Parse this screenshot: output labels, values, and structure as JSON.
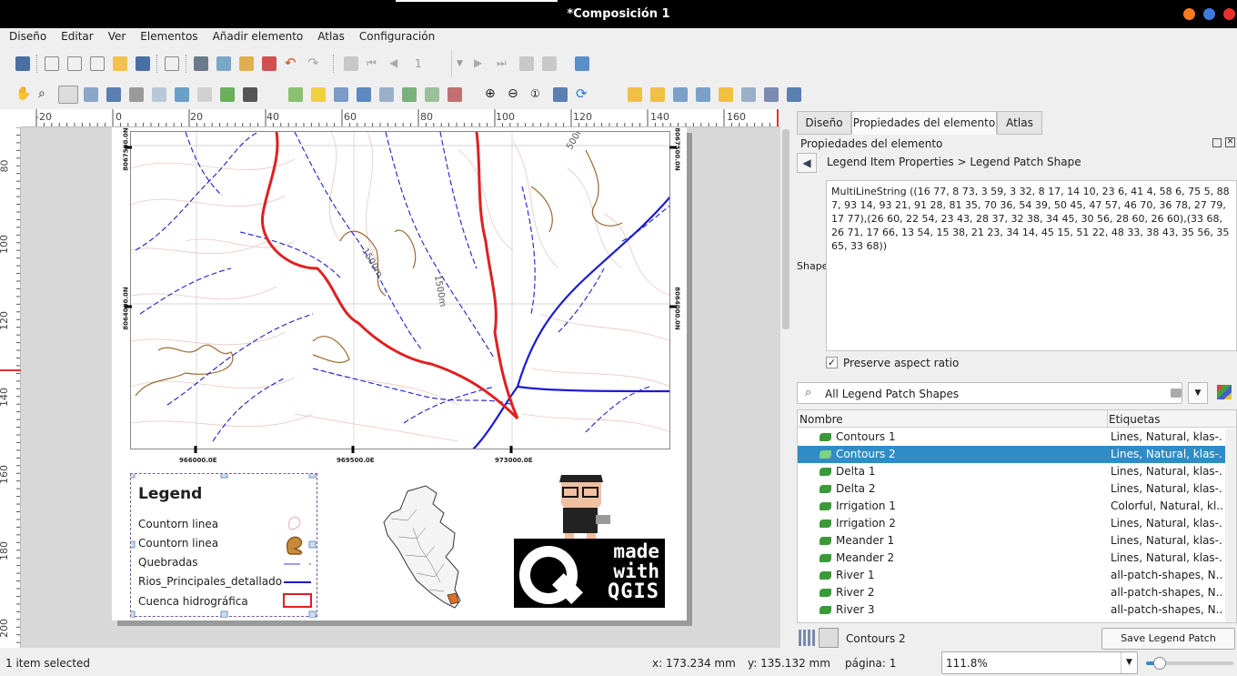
{
  "window": {
    "title": "*Composición 1"
  },
  "menubar": [
    "Diseño",
    "Editar",
    "Ver",
    "Elementos",
    "Añadir elemento",
    "Atlas",
    "Configuración"
  ],
  "toolbar": {
    "page_spin": "1"
  },
  "rulers": {
    "h_ticks": [
      "-20",
      "0",
      "20",
      "40",
      "60",
      "80",
      "100",
      "120",
      "140",
      "160"
    ],
    "v_ticks": [
      "80",
      "100",
      "120",
      "140",
      "160",
      "180",
      "200"
    ]
  },
  "map": {
    "coords_top_left": "8067500.0N",
    "coords_top_right": "8067500.0N",
    "coords_mid_left": "8064000.0N",
    "coords_mid_right": "8064000.0N",
    "x_labels": [
      "966000.0E",
      "969500.0E",
      "973000.0E"
    ],
    "contour_labels": [
      "1500m",
      "1500m",
      "500m"
    ]
  },
  "legend": {
    "title": "Legend",
    "items": [
      "Countorn linea",
      "Countorn linea",
      "Quebradas",
      "Rios_Principales_detallado",
      "Cuenca hidrográfica"
    ]
  },
  "logo": {
    "line1": "made",
    "line2": "with",
    "line3": "QGIS"
  },
  "panel": {
    "tabs": [
      "Diseño",
      "Propiedades del elemento",
      "Atlas"
    ],
    "header": "Propiedades del elemento",
    "breadcrumb": "Legend Item Properties > Legend Patch Shape",
    "shape_label": "Shape",
    "shape_text": "MultiLineString ((16 77, 8 73, 3 59, 3 32, 8 17, 14 10, 23 6, 41 4, 58 6, 75 5, 88 7, 93 14, 93 21, 91 28, 81 35, 70 36, 54 39, 50 45, 47 57, 46 70, 36 78, 27 79, 17 77),(26 60, 22 54, 23 43, 28 37, 32 38, 34 45, 30 56, 28 60, 26 60),(33 68, 26 71, 17 66, 13 54, 15 38, 21 23, 34 14, 45 15, 51 22, 48 33, 38 43, 35 56, 35 65, 33 68))",
    "preserve_label": "Preserve aspect ratio",
    "search_value": "All Legend Patch Shapes",
    "col_name": "Nombre",
    "col_tags": "Etiquetas",
    "rows": [
      {
        "name": "Contours 1",
        "tags": "Lines, Natural, klas-..."
      },
      {
        "name": "Contours 2",
        "tags": "Lines, Natural, klas-..."
      },
      {
        "name": "Delta 1",
        "tags": "Lines, Natural, klas-..."
      },
      {
        "name": "Delta 2",
        "tags": "Lines, Natural, klas-..."
      },
      {
        "name": "Irrigation 1",
        "tags": "Colorful, Natural, kl..."
      },
      {
        "name": "Irrigation 2",
        "tags": "Lines, Natural, klas-..."
      },
      {
        "name": "Meander 1",
        "tags": "Lines, Natural, klas-..."
      },
      {
        "name": "Meander 2",
        "tags": "Lines, Natural, klas-..."
      },
      {
        "name": "River 1",
        "tags": "all-patch-shapes, N..."
      },
      {
        "name": "River 2",
        "tags": "all-patch-shapes, N..."
      },
      {
        "name": "River 3",
        "tags": "all-patch-shapes, N..."
      }
    ],
    "selected_name": "Contours 2",
    "save_button": "Save Legend Patch Shape..."
  },
  "status": {
    "selection": "1 item selected",
    "x": "x: 173.234 mm",
    "y": "y: 135.132 mm",
    "page": "página: 1",
    "zoom": "111.8%"
  }
}
